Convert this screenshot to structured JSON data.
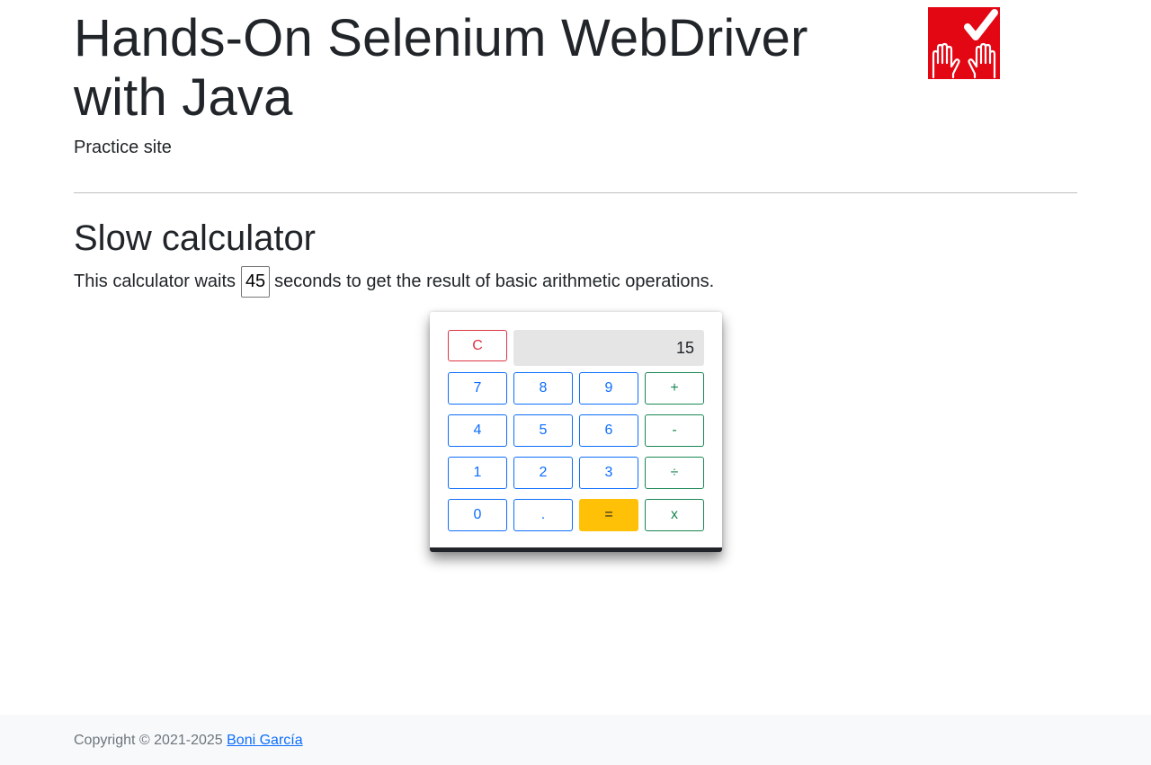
{
  "header": {
    "title": "Hands-On Selenium WebDriver with Java",
    "subtitle": "Practice site"
  },
  "section": {
    "title": "Slow calculator",
    "desc_before": "This calculator waits",
    "delay_value": "45",
    "desc_after": "seconds to get the result of basic arithmetic operations."
  },
  "calculator": {
    "screen": "15",
    "clear": "C",
    "keys": {
      "k7": "7",
      "k8": "8",
      "k9": "9",
      "plus": "+",
      "k4": "4",
      "k5": "5",
      "k6": "6",
      "minus": "-",
      "k1": "1",
      "k2": "2",
      "k3": "3",
      "divide": "÷",
      "k0": "0",
      "dot": ".",
      "equals": "=",
      "times": "x"
    }
  },
  "footer": {
    "copyright": "Copyright © 2021-2025",
    "author": "Boni García"
  },
  "colors": {
    "logo_red": "#e30613",
    "number_key": "#0d6efd",
    "operator_key": "#198754",
    "clear_key": "#dc3545",
    "equals_key": "#ffc107"
  },
  "icons": {
    "logo": "hands-checkmark-logo"
  }
}
